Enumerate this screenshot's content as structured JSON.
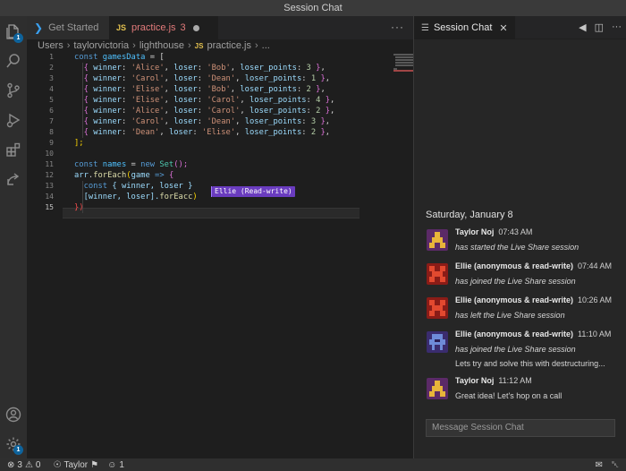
{
  "window": {
    "title": "Session Chat"
  },
  "activity_bar": {
    "explorer_badge": "1",
    "settings_badge": "1"
  },
  "tabs": [
    {
      "label": "Get Started"
    },
    {
      "label": "practice.js",
      "problems": "3",
      "file_type": "JS"
    }
  ],
  "breadcrumb": {
    "parts": [
      "Users",
      "taylorvictoria",
      "lighthouse",
      "practice.js",
      "..."
    ],
    "file_type": "JS"
  },
  "editor": {
    "line_numbers": [
      "1",
      "2",
      "3",
      "4",
      "5",
      "6",
      "7",
      "8",
      "9",
      "10",
      "11",
      "12",
      "13",
      "14",
      "15"
    ],
    "presence_label": "Ellie (Read-write)",
    "code": {
      "l1_const": "const",
      "l1_name": "gamesData",
      "l1_rest": " = [",
      "rows": [
        {
          "w": "'Alice'",
          "l": "'Bob'",
          "p": "3"
        },
        {
          "w": "'Carol'",
          "l": "'Dean'",
          "p": "1"
        },
        {
          "w": "'Elise'",
          "l": "'Bob'",
          "p": "2"
        },
        {
          "w": "'Elise'",
          "l": "'Carol'",
          "p": "4"
        },
        {
          "w": "'Alice'",
          "l": "'Carol'",
          "p": "2"
        },
        {
          "w": "'Carol'",
          "l": "'Dean'",
          "p": "3"
        },
        {
          "w": "'Dean'",
          "l": "'Elise'",
          "p": "2"
        }
      ],
      "k_winner": "winner",
      "k_loser": "loser",
      "k_points": "loser_points",
      "l9": "];",
      "l11_const": "const",
      "l11_name": "names",
      "l11_eq": " = ",
      "l11_new": "new",
      "l11_set": "Set",
      "l11_end": "();",
      "l12_arr": "arr",
      "l12_dot": ".",
      "l12_fn": "forEach",
      "l12_param": "game",
      "l12_arrow": " => ",
      "l13_const": "const",
      "l13_rest": " { winner, loser }",
      "l14_a": "[winner, loser].",
      "l14_fn": "forEacc",
      "l14_end": ")",
      "l15": "})"
    }
  },
  "chat": {
    "tab_label": "Session Chat",
    "date": "Saturday, January 8",
    "messages": [
      {
        "author": "Taylor Noj",
        "time": "07:43 AM",
        "lines": [
          "has started the Live Share session"
        ],
        "italic": true
      },
      {
        "author": "Ellie (anonymous & read-write)",
        "time": "07:44 AM",
        "lines": [
          "has joined the Live Share session"
        ],
        "italic": true
      },
      {
        "author": "Ellie (anonymous & read-write)",
        "time": "10:26 AM",
        "lines": [
          "has left the Live Share session"
        ],
        "italic": true
      },
      {
        "author": "Ellie (anonymous & read-write)",
        "time": "11:10 AM",
        "lines": [
          "has joined the Live Share session",
          "Lets try and solve this with destructuring..."
        ],
        "italic": true
      },
      {
        "author": "Taylor Noj",
        "time": "11:12 AM",
        "lines": [
          "Great idea! Let's hop on a call"
        ],
        "italic": false
      }
    ],
    "input_placeholder": "Message Session Chat"
  },
  "status_bar": {
    "errors": "3",
    "warnings": "0",
    "user": "Taylor",
    "participants": "1"
  },
  "colors": {
    "presence": "#6a3cbf",
    "accent_blue": "#0e639c",
    "error": "#e37b7b",
    "avatar_taylor": "#5b2a67",
    "avatar_ellie": "#8a1c17",
    "avatar_ellie_blue": "#3a2c6e"
  }
}
